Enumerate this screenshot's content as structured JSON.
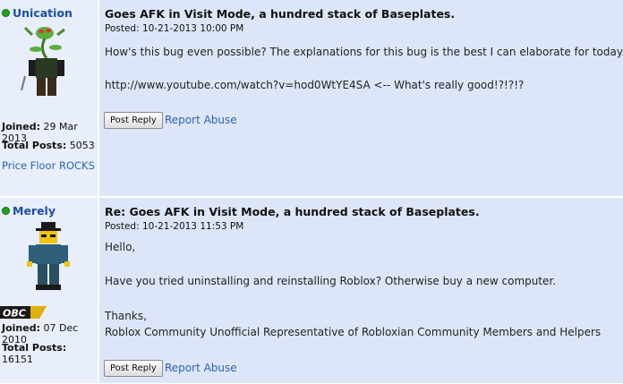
{
  "posts": [
    {
      "username": "Unication",
      "title": "Goes AFK in Visit Mode, a hundred stack of Baseplates.",
      "posted": "Posted: 10-21-2013 10:00 PM",
      "lines": [
        "How's this bug even possible? The explanations for this bug is the best I can elaborate for today.",
        "http://www.youtube.com/watch?v=hod0WtYE4SA <-- What's really good!?!?!?"
      ],
      "joined_label": "Joined:",
      "joined_value": "29 Mar 2013",
      "total_posts_label": "Total Posts:",
      "total_posts_value": "5053",
      "signature_link": "Price Floor ROCKS",
      "reply_button": "Post Reply",
      "report_link": "Report Abuse"
    },
    {
      "username": "Merely",
      "title": "Re: Goes AFK in Visit Mode, a hundred stack of Baseplates.",
      "posted": "Posted: 10-21-2013 11:53 PM",
      "lines": [
        "Hello,",
        "Have you tried uninstalling and reinstalling Roblox? Otherwise buy a new computer.",
        "Thanks,",
        "Roblox Community Unofficial Representative of Robloxian Community Members and Helpers"
      ],
      "badge": "OBC",
      "joined_label": "Joined:",
      "joined_value": "07 Dec 2010",
      "total_posts_label": "Total Posts:",
      "total_posts_value": "16151",
      "reply_button": "Post Reply",
      "report_link": "Report Abuse"
    }
  ],
  "colors": {
    "sidebar_bg": "#e8eefb",
    "body_bg": "#dde6f8",
    "link": "#2a62b8",
    "username": "#1b4fa8",
    "online": "#1fa21f"
  }
}
